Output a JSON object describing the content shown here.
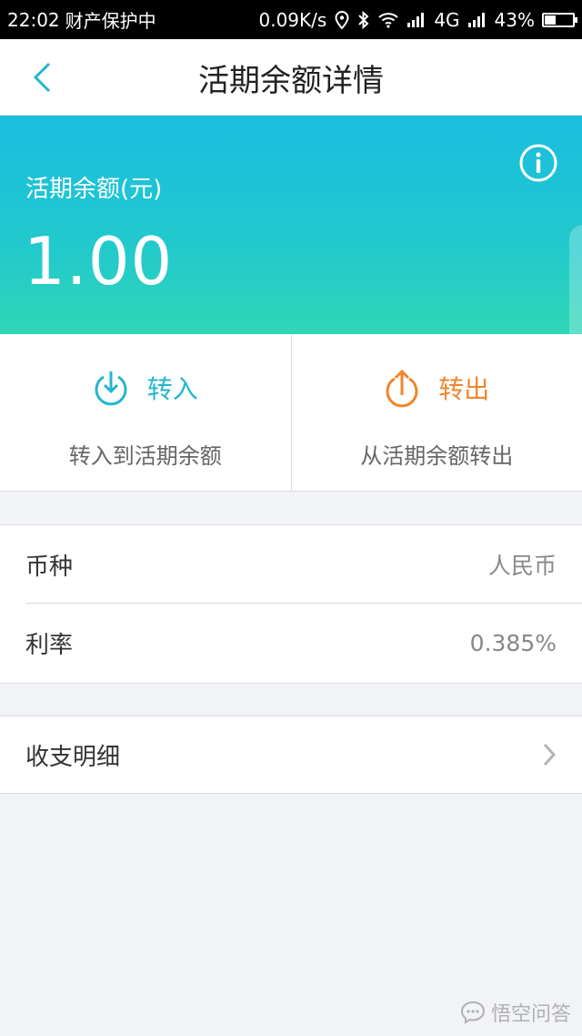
{
  "status_bar": {
    "time": "22:02",
    "notice": "财产保护中",
    "speed": "0.09K/s",
    "network": "4G",
    "battery": "43%",
    "battery_level": 0.43
  },
  "nav": {
    "title": "活期余额详情",
    "back_icon": "chevron-left-icon"
  },
  "balance": {
    "label": "活期余额(元)",
    "amount": "1.00",
    "info_icon": "info-icon"
  },
  "actions": {
    "transfer_in": {
      "label": "转入",
      "subtitle": "转入到活期余额",
      "color": "#24b6cf",
      "icon": "download-circle-icon"
    },
    "transfer_out": {
      "label": "转出",
      "subtitle": "从活期余额转出",
      "color": "#f0862b",
      "icon": "upload-circle-icon"
    }
  },
  "info": {
    "currency": {
      "label": "币种",
      "value": "人民币"
    },
    "rate": {
      "label": "利率",
      "value": "0.385%"
    }
  },
  "details": {
    "label": "收支明细",
    "icon": "chevron-right-icon"
  },
  "watermark": {
    "text": "悟空问答"
  },
  "colors": {
    "banner_top": "#19bde0",
    "banner_bottom": "#2fd6b6",
    "back_icon": "#24b6cf"
  }
}
